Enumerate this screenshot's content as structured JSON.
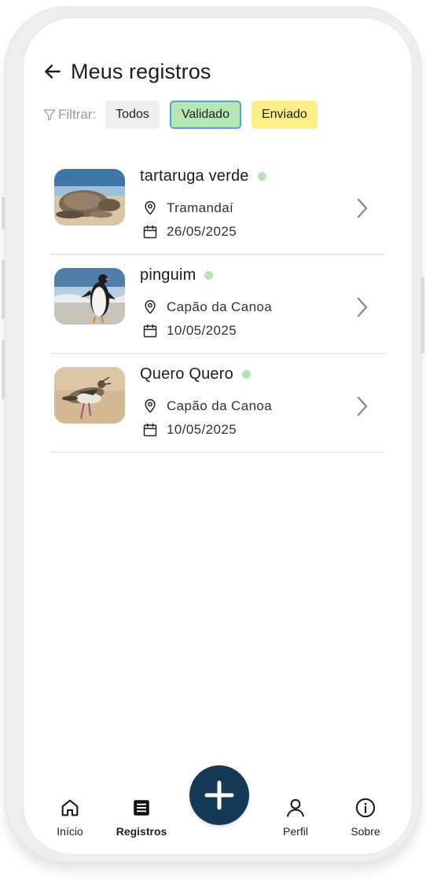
{
  "header": {
    "title": "Meus registros"
  },
  "filters": {
    "label": "Filtrar:",
    "options": [
      "Todos",
      "Validado",
      "Enviado"
    ],
    "selected": "Validado"
  },
  "records": [
    {
      "name": "tartaruga verde",
      "location": "Tramandaí",
      "date": "26/05/2025",
      "status_color": "#b7e3b3"
    },
    {
      "name": "pinguim",
      "location": "Capão da Canoa",
      "date": "10/05/2025",
      "status_color": "#b7e3b3"
    },
    {
      "name": "Quero Quero",
      "location": "Capão da Canoa",
      "date": "10/05/2025",
      "status_color": "#b7e3b3"
    }
  ],
  "bottom_nav": {
    "items": [
      {
        "label": "Início",
        "icon": "home-icon"
      },
      {
        "label": "Registros",
        "icon": "list-icon",
        "active": true
      },
      {
        "label": "Perfil",
        "icon": "user-icon"
      },
      {
        "label": "Sobre",
        "icon": "info-icon"
      }
    ],
    "fab_icon": "plus-icon"
  },
  "colors": {
    "primary": "#143a58",
    "chip_validado": "#b6e6b4",
    "chip_validado_border": "#4aa4e0",
    "chip_enviado": "#fbef86",
    "chip_todos": "#efefef",
    "status_dot": "#b7e3b3"
  }
}
